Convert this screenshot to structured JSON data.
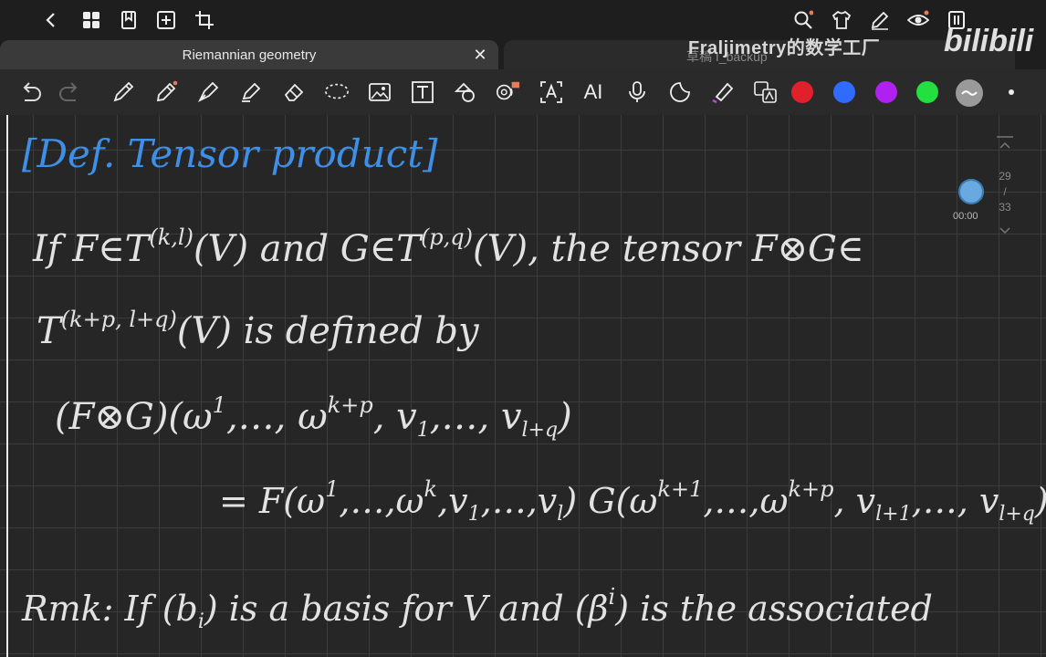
{
  "tabs": {
    "active_title": "Riemannian geometry",
    "inactive_title": "草稿 I_backup",
    "close_glyph": "✕"
  },
  "watermark": {
    "channel": "Fraljimetry的数学工厂",
    "logo": "bilibili"
  },
  "toolbar": {
    "ai_label": "AI",
    "colors": [
      "#e0202a",
      "#2f6bff",
      "#b020f0",
      "#22e040",
      "#9a9a9a"
    ]
  },
  "pager": {
    "current": "29",
    "separator": "/",
    "total": "33"
  },
  "recorder": {
    "time": "00:00"
  },
  "note": {
    "heading": "[Def. Tensor product]",
    "l1_a": "If F∈T",
    "l1_sup1": "(k,l)",
    "l1_b": "(V) and G∈T",
    "l1_sup2": "(p,q)",
    "l1_c": "(V), the tensor F⊗G∈",
    "l2_a": "T",
    "l2_sup": "(k+p, l+q)",
    "l2_b": "(V) is defined by",
    "l3_a": "(F⊗G)(ω",
    "l3_sup1": "1",
    "l3_b": ",…, ω",
    "l3_sup2": "k+p",
    "l3_c": ", v",
    "l3_sub1": "1",
    "l3_d": ",…, v",
    "l3_sub2": "l+q",
    "l3_e": ")",
    "l4_a": "= F(ω",
    "l4_sup1": "1",
    "l4_b": ",…,ω",
    "l4_sup2": "k",
    "l4_c": ",v",
    "l4_sub1": "1",
    "l4_d": ",…,v",
    "l4_sub2": "l",
    "l4_e": ") G(ω",
    "l4_sup3": "k+1",
    "l4_f": ",…,ω",
    "l4_sup4": "k+p",
    "l4_g": ", v",
    "l4_sub3": "l+1",
    "l4_h": ",…, v",
    "l4_sub4": "l+q",
    "l4_i": ")",
    "l5_a": "Rmk: If (b",
    "l5_sub1": "i",
    "l5_b": ") is a basis for V and (β",
    "l5_sup1": "i",
    "l5_c": ") is the associated"
  }
}
